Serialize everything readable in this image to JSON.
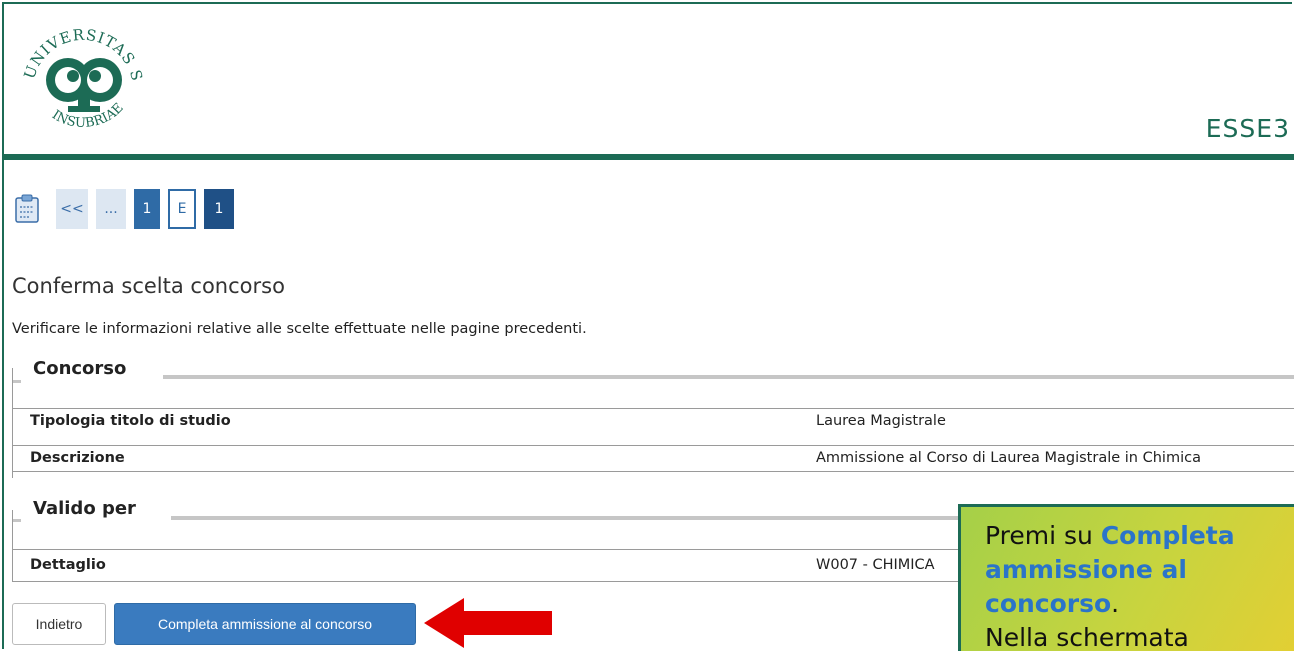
{
  "header": {
    "logo_text": "UNIVERSITAS STUDIORUM INSUBRIAE",
    "brand": "ESSE3"
  },
  "breadcrumb": {
    "items": [
      "<<",
      "...",
      "1",
      "E",
      "1"
    ]
  },
  "page": {
    "title": "Conferma scelta concorso",
    "subtitle": "Verificare le informazioni relative alle scelte effettuate nelle pagine precedenti."
  },
  "concorso": {
    "legend": "Concorso",
    "rows": [
      {
        "label": "Tipologia titolo di studio",
        "value": "Laurea Magistrale"
      },
      {
        "label": "Descrizione",
        "value": "Ammissione al Corso di Laurea Magistrale in Chimica"
      }
    ]
  },
  "valido_per": {
    "legend": "Valido per",
    "rows": [
      {
        "label": "Dettaglio",
        "value": "W007 - CHIMICA"
      }
    ]
  },
  "buttons": {
    "back": "Indietro",
    "complete": "Completa ammissione al concorso"
  },
  "note": {
    "prefix": "Premi su ",
    "highlight": "Completa ammissione al concorso",
    "suffix": ".",
    "line2": "Nella schermata"
  },
  "colors": {
    "brand_green": "#1c6b55",
    "primary_blue": "#3a7bbf",
    "arrow_red": "#e00000"
  }
}
